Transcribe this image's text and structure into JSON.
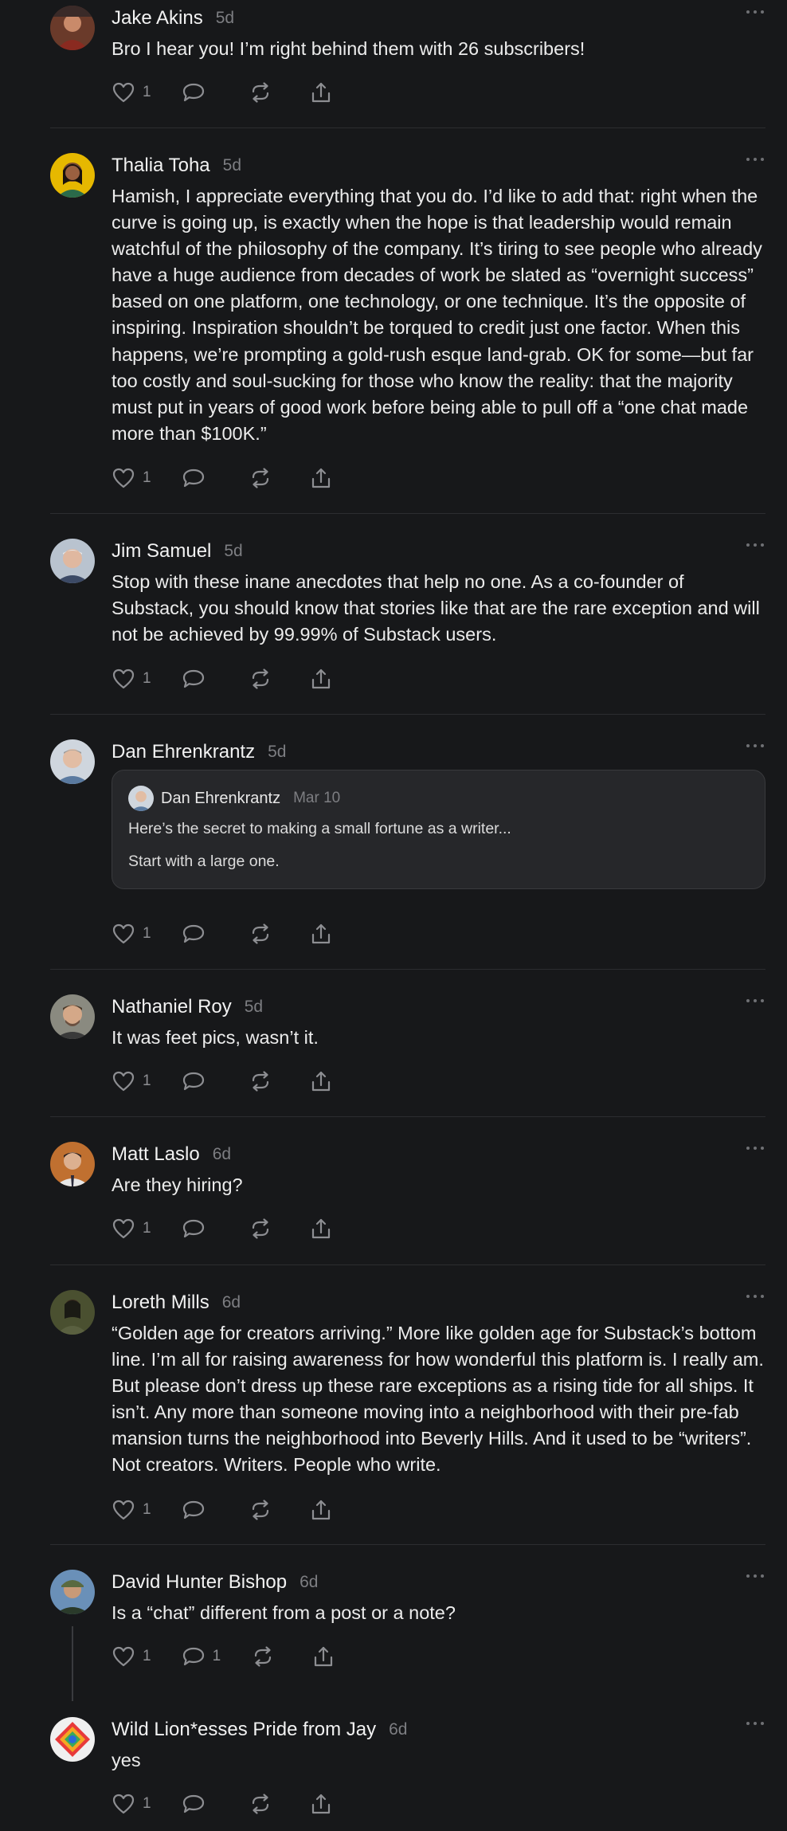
{
  "comments": [
    {
      "name": "Jake Akins",
      "time": "5d",
      "text": "Bro I hear you! I’m right behind them with 26 subscribers!",
      "likes": "1",
      "replies": ""
    },
    {
      "name": "Thalia Toha",
      "time": "5d",
      "text": "Hamish, I appreciate everything that you do. I’d like to add that: right when the curve is going up, is exactly when the hope is that leadership would remain watchful of the philosophy of the company. It’s tiring to see people who already have a huge audience from decades of work be slated as “overnight success” based on one platform, one technology, or one technique. It’s the opposite of inspiring. Inspiration shouldn’t be torqued to credit just one factor. When this happens, we’re prompting a gold-rush esque land-grab. OK for some—but far too costly and soul-sucking for those who know the reality: that the majority must put in years of good work before being able to pull off a “one chat made more than $100K.”",
      "likes": "1",
      "replies": ""
    },
    {
      "name": "Jim Samuel",
      "time": "5d",
      "text": "Stop with these inane anecdotes that help no one. As a co-founder of Substack, you should know that stories like that are the rare exception and will not be achieved by 99.99% of Substack users.",
      "likes": "1",
      "replies": ""
    },
    {
      "name": "Dan Ehrenkrantz",
      "time": "5d",
      "text": "",
      "likes": "1",
      "replies": "",
      "quote": {
        "name": "Dan Ehrenkrantz",
        "time": "Mar 10",
        "line1": "Here’s the secret to making a small fortune as a writer...",
        "line2": "Start with a large one."
      }
    },
    {
      "name": "Nathaniel Roy",
      "time": "5d",
      "text": "It was feet pics, wasn’t it.",
      "likes": "1",
      "replies": ""
    },
    {
      "name": "Matt Laslo",
      "time": "6d",
      "text": "Are they hiring?",
      "likes": "1",
      "replies": ""
    },
    {
      "name": "Loreth Mills",
      "time": "6d",
      "text": "“Golden age for creators arriving.” More like golden age for Substack’s bottom line. I’m all for raising awareness for how wonderful this platform is. I really am. But please don’t dress up these rare exceptions as a rising tide for all ships. It isn’t. Any more than someone moving into a neighborhood with their pre-fab mansion turns the neighborhood into Beverly Hills. And it used to be “writers”. Not creators. Writers. People who write.",
      "likes": "1",
      "replies": ""
    },
    {
      "name": "David Hunter Bishop",
      "time": "6d",
      "text": "Is a “chat” different from a post or a note?",
      "likes": "1",
      "replies": "1"
    },
    {
      "name": "Wild Lion*esses Pride from Jay",
      "time": "6d",
      "text": "yes",
      "likes": "1",
      "replies": ""
    }
  ]
}
